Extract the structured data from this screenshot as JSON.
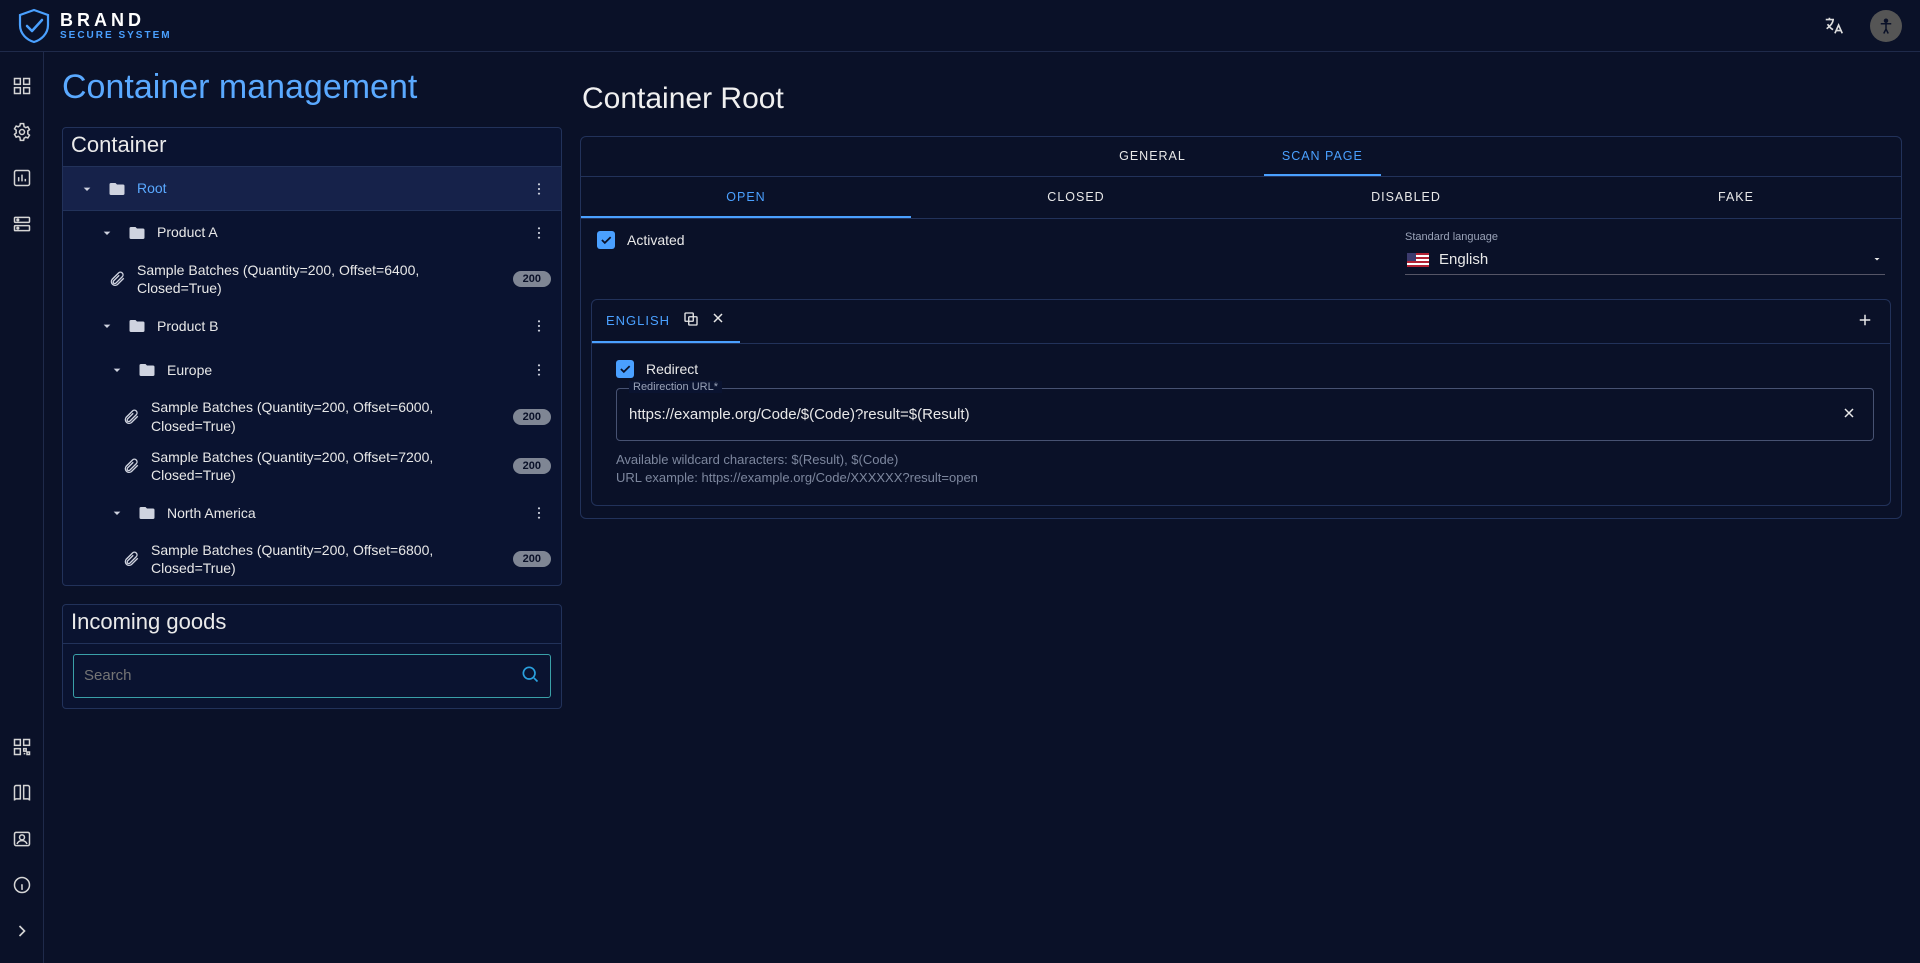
{
  "brand": {
    "line1": "BRAND",
    "line2": "SECURE SYSTEM"
  },
  "page": {
    "title": "Container management"
  },
  "containerPanel": {
    "header": "Container"
  },
  "tree": [
    {
      "id": "root",
      "depth": 0,
      "type": "folder",
      "label": "Root",
      "selected": true,
      "menu": true
    },
    {
      "id": "pa",
      "depth": 1,
      "type": "folder",
      "label": "Product A",
      "selected": false,
      "menu": true
    },
    {
      "id": "pa-b1",
      "depth": 2,
      "type": "batch",
      "label": "Sample Batches (Quantity=200, Offset=6400, Closed=True)",
      "badge": "200"
    },
    {
      "id": "pb",
      "depth": 1,
      "type": "folder",
      "label": "Product B",
      "selected": false,
      "menu": true
    },
    {
      "id": "eu",
      "depth": 2,
      "type": "folder",
      "label": "Europe",
      "selected": false,
      "menu": true
    },
    {
      "id": "eu-b1",
      "depth": 3,
      "type": "batch",
      "label": "Sample Batches (Quantity=200, Offset=6000, Closed=True)",
      "badge": "200"
    },
    {
      "id": "eu-b2",
      "depth": 3,
      "type": "batch",
      "label": "Sample Batches (Quantity=200, Offset=7200, Closed=True)",
      "badge": "200"
    },
    {
      "id": "na",
      "depth": 2,
      "type": "folder",
      "label": "North America",
      "selected": false,
      "menu": true
    },
    {
      "id": "na-b1",
      "depth": 3,
      "type": "batch",
      "label": "Sample Batches (Quantity=200, Offset=6800, Closed=True)",
      "badge": "200"
    }
  ],
  "incoming": {
    "header": "Incoming goods",
    "search_placeholder": "Search"
  },
  "right": {
    "title": "Container Root",
    "primaryTabs": [
      {
        "label": "General",
        "active": false
      },
      {
        "label": "Scan page",
        "active": true
      }
    ],
    "secondaryTabs": [
      {
        "label": "Open",
        "active": true
      },
      {
        "label": "Closed",
        "active": false
      },
      {
        "label": "Disabled",
        "active": false
      },
      {
        "label": "Fake",
        "active": false
      }
    ],
    "activated": {
      "checked": true,
      "label": "Activated"
    },
    "standardLanguage": {
      "hint": "Standard language",
      "value": "English"
    },
    "langTabs": [
      {
        "label": "English",
        "active": true
      }
    ],
    "redirect": {
      "checked": true,
      "label": "Redirect"
    },
    "redirectionUrl": {
      "legend": "Redirection URL*",
      "value": "https://example.org/Code/$(Code)?result=$(Result)"
    },
    "hints": {
      "line1": "Available wildcard characters: $(Result), $(Code)",
      "line2": "URL example: https://example.org/Code/XXXXXX?result=open"
    }
  }
}
